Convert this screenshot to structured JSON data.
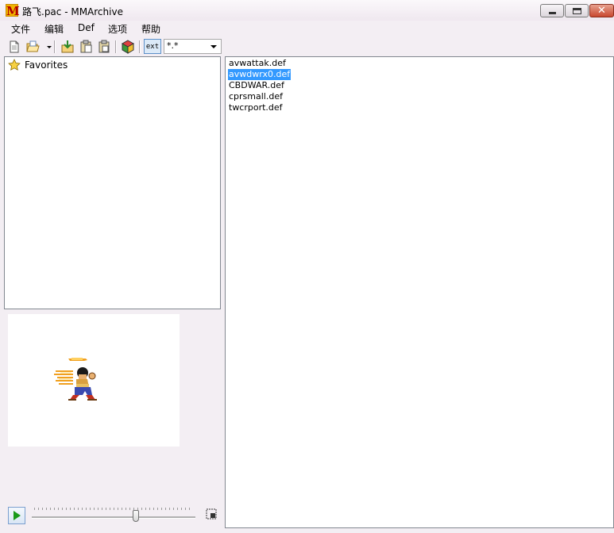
{
  "window": {
    "title": "路飞.pac - MMArchive",
    "icon_letter": "M",
    "close_glyph": "✕"
  },
  "menu": [
    "文件",
    "编辑",
    "Def",
    "选项",
    "帮助"
  ],
  "toolbar": {
    "ext_label": "ext",
    "filter_value": "*.*"
  },
  "tree": {
    "items": [
      {
        "label": "Favorites",
        "icon": "star-icon"
      }
    ]
  },
  "files": {
    "items": [
      "avwattak.def",
      "avwdwrx0.def",
      "CBDWAR.def",
      "cprsmall.def",
      "twcrport.def"
    ],
    "selected_index": 1
  },
  "playback": {
    "slider_position": 0.64
  },
  "colors": {
    "selection": "#3399ff",
    "play_icon": "#1a9a1a"
  }
}
